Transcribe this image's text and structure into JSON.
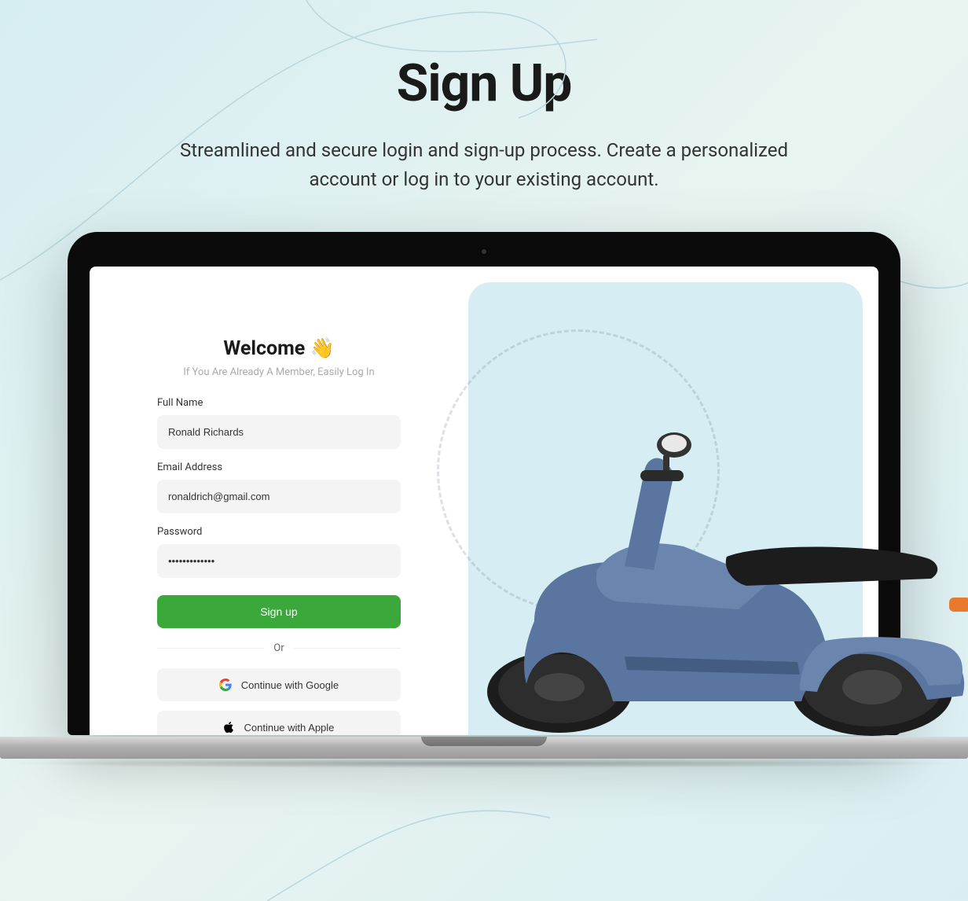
{
  "page": {
    "title": "Sign Up",
    "subtitle": "Streamlined and secure login and sign-up process. Create a personalized account or log in to your existing account."
  },
  "form": {
    "welcome": "Welcome 👋",
    "welcome_sub": "If You Are Already A Member, Easily Log In",
    "full_name_label": "Full Name",
    "full_name_value": "Ronald Richards",
    "email_label": "Email Address",
    "email_value": "ronaldrich@gmail.com",
    "password_label": "Password",
    "password_value": "•••••••••••••",
    "signup_button": "Sign up",
    "divider": "Or",
    "google_button": "Continue with Google",
    "apple_button": "Continue with Apple"
  },
  "illustration": "scooter"
}
